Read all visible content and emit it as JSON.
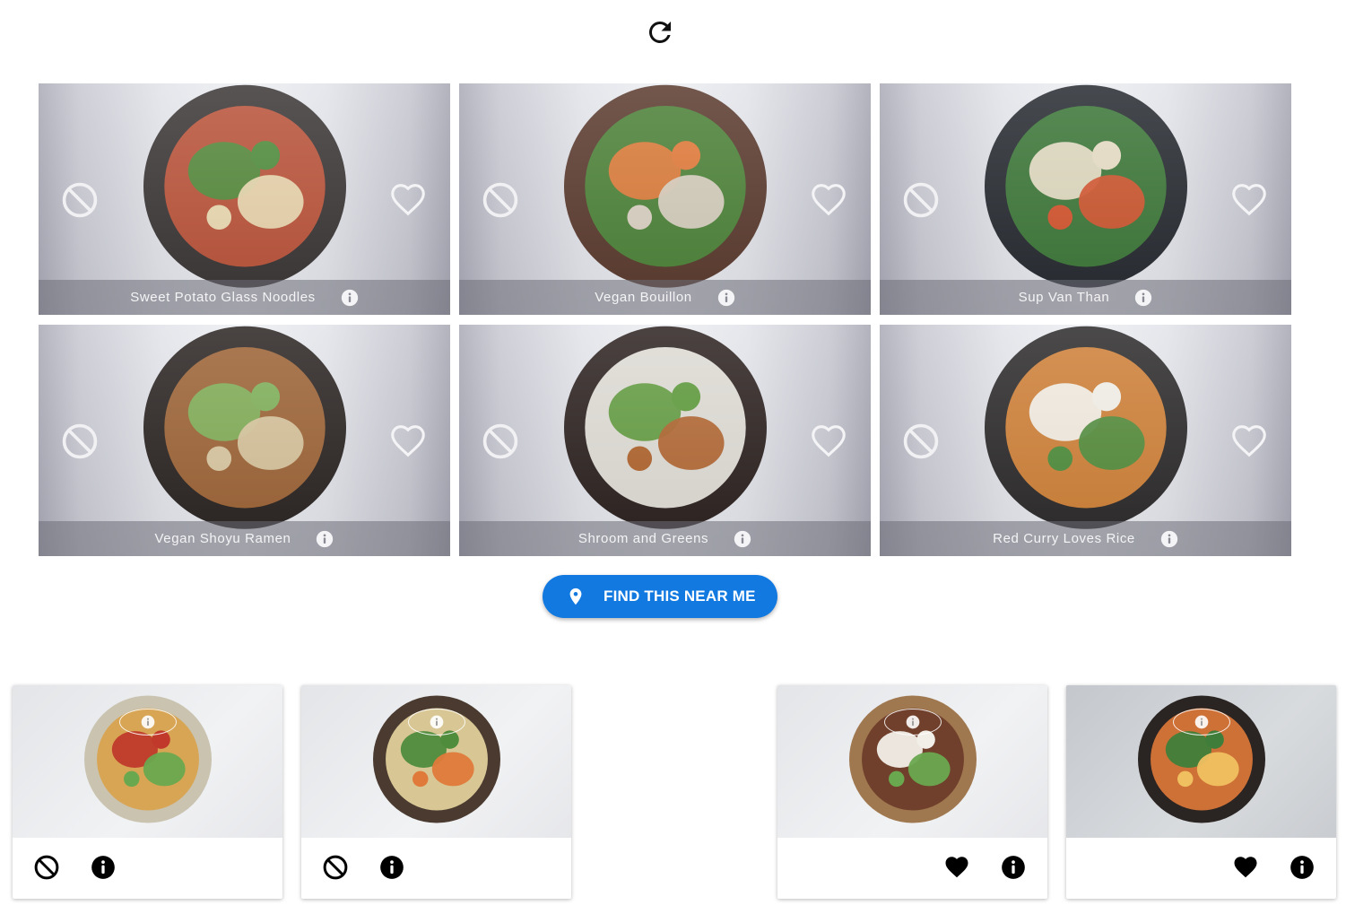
{
  "toolbar": {
    "refresh_icon": "refresh-icon"
  },
  "dishes": [
    {
      "name": "Sweet Potato Glass Noodles",
      "bowl": "#3b3636",
      "food": [
        "#c8563b",
        "#4f8c3c",
        "#e9d8b0"
      ]
    },
    {
      "name": "Vegan Bouillon",
      "bowl": "#5a3a2e",
      "food": [
        "#4a8a3a",
        "#e07a3a",
        "#d8cfc0"
      ]
    },
    {
      "name": "Sup Van Than",
      "bowl": "#262a30",
      "food": [
        "#3f7e3a",
        "#e6dcc4",
        "#d2542e"
      ]
    },
    {
      "name": "Vegan Shoyu Ramen",
      "bowl": "#2a2422",
      "food": [
        "#a86a38",
        "#7fb05a",
        "#d8c6a0"
      ]
    },
    {
      "name": "Shroom and Greens",
      "bowl": "#2c2220",
      "food": [
        "#f2efe8",
        "#5e9a3c",
        "#b0642e"
      ]
    },
    {
      "name": "Red Curry Loves Rice",
      "bowl": "#2c2a2a",
      "food": [
        "#e08a3a",
        "#f2efe8",
        "#4f8c3c"
      ]
    }
  ],
  "find_button": {
    "label": "FIND THIS NEAR ME",
    "icon": "location-pin-icon"
  },
  "history": [
    {
      "status": "rejected",
      "bowl": "#c9c3b0",
      "food": [
        "#d9a24a",
        "#c0392b",
        "#6aa84f"
      ],
      "dark": false
    },
    {
      "status": "rejected",
      "bowl": "#4a3a30",
      "food": [
        "#e8d7a0",
        "#4f8c3c",
        "#e07a3a"
      ],
      "dark": false
    },
    {
      "status": "liked",
      "bowl": "#a07850",
      "food": [
        "#6a3a28",
        "#f2efe8",
        "#6aa84f"
      ],
      "dark": false
    },
    {
      "status": "liked",
      "bowl": "#2a2422",
      "food": [
        "#e07a3a",
        "#3f7e3a",
        "#f0c060"
      ],
      "dark": true
    }
  ],
  "colors": {
    "accent": "#1279e0",
    "caption_text": "#f4f4f6"
  }
}
